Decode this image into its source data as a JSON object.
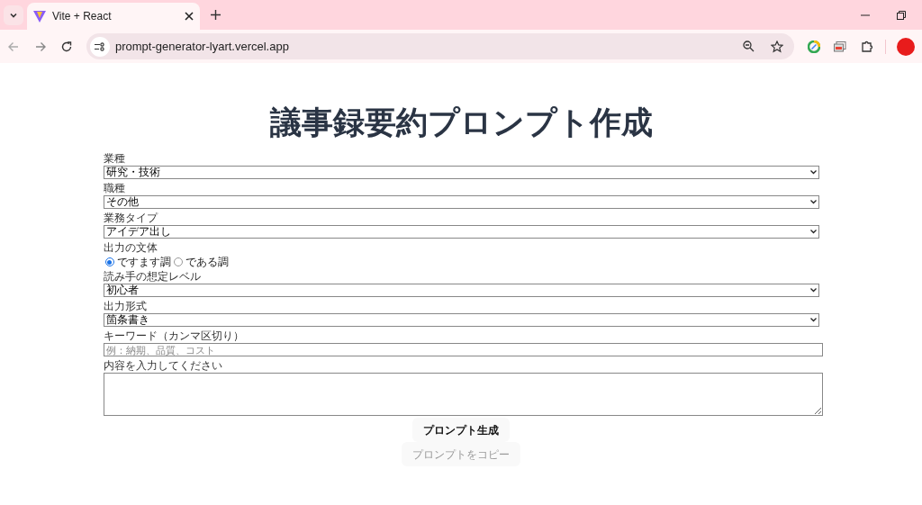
{
  "browser": {
    "tab_title": "Vite + React",
    "url": "prompt-generator-lyart.vercel.app"
  },
  "page": {
    "title": "議事録要約プロンプト作成",
    "fields": [
      {
        "kind": "select",
        "label": "業種",
        "value": "研究・技術"
      },
      {
        "kind": "select",
        "label": "職種",
        "value": "その他"
      },
      {
        "kind": "select",
        "label": "業務タイプ",
        "value": "アイデア出し"
      },
      {
        "kind": "radio",
        "label": "出力の文体",
        "options": [
          {
            "label": "ですます調",
            "selected": true
          },
          {
            "label": "である調",
            "selected": false
          }
        ]
      },
      {
        "kind": "select",
        "label": "読み手の想定レベル",
        "value": "初心者"
      },
      {
        "kind": "select",
        "label": "出力形式",
        "value": "箇条書き"
      },
      {
        "kind": "text",
        "label": "キーワード（カンマ区切り）",
        "placeholder": "例：納期、品質、コスト"
      },
      {
        "kind": "textarea",
        "label": "内容を入力してください"
      }
    ],
    "buttons": [
      {
        "label": "プロンプト生成",
        "disabled": false
      },
      {
        "label": "プロンプトをコピー",
        "disabled": true
      }
    ]
  }
}
